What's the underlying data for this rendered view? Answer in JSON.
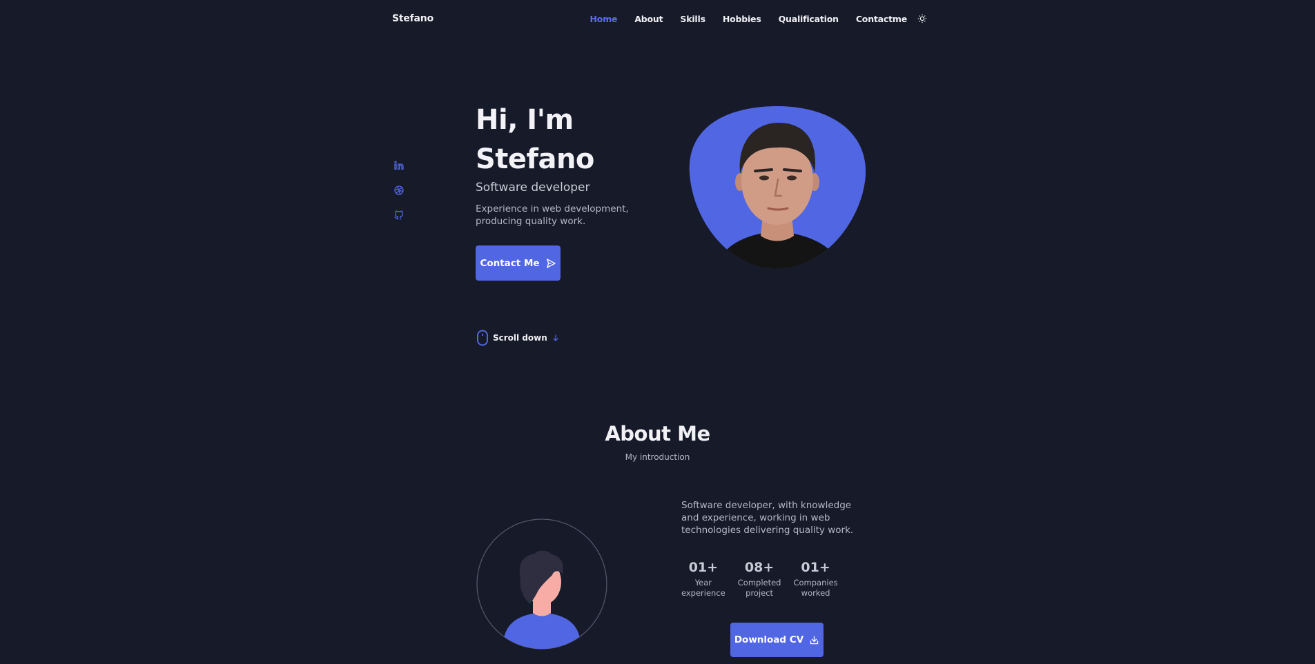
{
  "nav": {
    "logo": "Stefano",
    "items": [
      {
        "label": "Home",
        "active": true
      },
      {
        "label": "About",
        "active": false
      },
      {
        "label": "Skills",
        "active": false
      },
      {
        "label": "Hobbies",
        "active": false
      },
      {
        "label": "Qualification",
        "active": false
      },
      {
        "label": "Contactme",
        "active": false
      }
    ],
    "theme_icon": "sun-icon"
  },
  "social": [
    {
      "icon": "linkedin-icon"
    },
    {
      "icon": "dribbble-icon"
    },
    {
      "icon": "github-icon"
    }
  ],
  "hero": {
    "title_line1": "Hi, I'm",
    "title_line2": "Stefano",
    "subtitle": "Software developer",
    "description": "Experience in web development, producing quality work.",
    "contact_button": "Contact Me",
    "scroll_label": "Scroll down"
  },
  "about": {
    "title": "About Me",
    "subtitle": "My introduction",
    "description": "Software developer, with knowledge and experience, working in web technologies delivering quality work.",
    "stats": [
      {
        "value": "01+",
        "label_line1": "Year",
        "label_line2": "experience"
      },
      {
        "value": "08+",
        "label_line1": "Completed",
        "label_line2": "project"
      },
      {
        "value": "01+",
        "label_line1": "Companies",
        "label_line2": "worked"
      }
    ],
    "cv_button": "Download CV"
  },
  "colors": {
    "background": "#171a28",
    "accent": "#5066e3",
    "text": "#f0f0f5",
    "muted": "#b5b8c6"
  }
}
